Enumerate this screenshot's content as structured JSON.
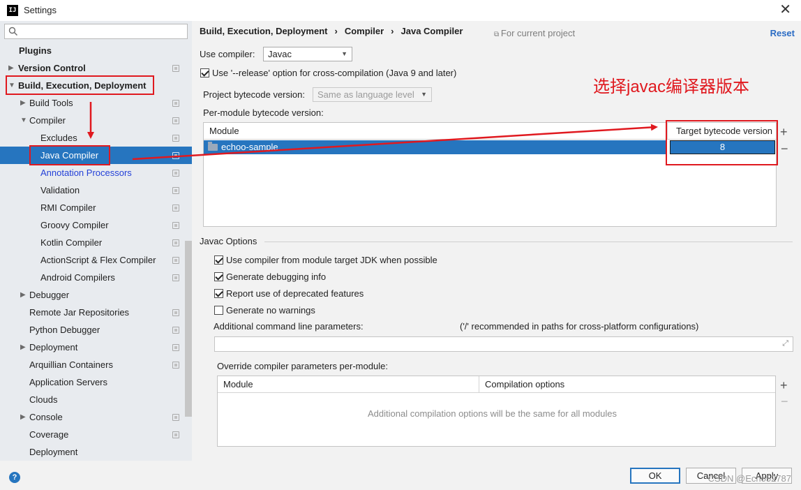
{
  "window": {
    "title": "Settings"
  },
  "sidebar": {
    "items": [
      {
        "label": "Plugins"
      },
      {
        "label": "Version Control"
      },
      {
        "label": "Build, Execution, Deployment"
      },
      {
        "label": "Build Tools"
      },
      {
        "label": "Compiler"
      },
      {
        "label": "Excludes"
      },
      {
        "label": "Java Compiler"
      },
      {
        "label": "Annotation Processors"
      },
      {
        "label": "Validation"
      },
      {
        "label": "RMI Compiler"
      },
      {
        "label": "Groovy Compiler"
      },
      {
        "label": "Kotlin Compiler"
      },
      {
        "label": "ActionScript & Flex Compiler"
      },
      {
        "label": "Android Compilers"
      },
      {
        "label": "Debugger"
      },
      {
        "label": "Remote Jar Repositories"
      },
      {
        "label": "Python Debugger"
      },
      {
        "label": "Deployment"
      },
      {
        "label": "Arquillian Containers"
      },
      {
        "label": "Application Servers"
      },
      {
        "label": "Clouds"
      },
      {
        "label": "Console"
      },
      {
        "label": "Coverage"
      },
      {
        "label": "Deployment"
      }
    ]
  },
  "header": {
    "breadcrumb": [
      "Build, Execution, Deployment",
      "Compiler",
      "Java Compiler"
    ],
    "breadcrumb_sep": "›",
    "for_current_project": "For current project",
    "reset": "Reset"
  },
  "main": {
    "use_compiler_label": "Use compiler:",
    "use_compiler_value": "Javac",
    "release_option_label": "Use '--release' option for cross-compilation (Java 9 and later)",
    "project_bytecode_label": "Project bytecode version:",
    "project_bytecode_placeholder": "Same as language level",
    "per_module_label": "Per-module bytecode version:",
    "module_table": {
      "columns": [
        "Module",
        "Target bytecode version"
      ],
      "rows": [
        {
          "module": "echoo-sample",
          "version": "8"
        }
      ]
    },
    "javac_options": {
      "title": "Javac Options",
      "checkboxes": [
        {
          "label": "Use compiler from module target JDK when possible",
          "checked": true
        },
        {
          "label": "Generate debugging info",
          "checked": true
        },
        {
          "label": "Report use of deprecated features",
          "checked": true
        },
        {
          "label": "Generate no warnings",
          "checked": false
        }
      ],
      "additional_params_label": "Additional command line parameters:",
      "additional_params_hint": "('/' recommended in paths for cross-platform configurations)"
    },
    "override": {
      "label": "Override compiler parameters per-module:",
      "columns": [
        "Module",
        "Compilation options"
      ],
      "empty_text": "Additional compilation options will be the same for all modules"
    }
  },
  "annotation": {
    "text": "选择javac编译器版本"
  },
  "footer": {
    "ok": "OK",
    "cancel": "Cancel",
    "apply": "Apply",
    "watermark": "CSDN @Echo52787"
  },
  "colors": {
    "accent": "#2675bf",
    "annotation_red": "#e0191f",
    "link_blue": "#2340d8"
  },
  "icons": [
    "app-icon",
    "close-icon",
    "search-icon",
    "chevron-right-icon",
    "chevron-down-icon",
    "page-icon",
    "folder-icon",
    "plus-icon",
    "minus-icon",
    "expand-icon",
    "help-icon"
  ]
}
